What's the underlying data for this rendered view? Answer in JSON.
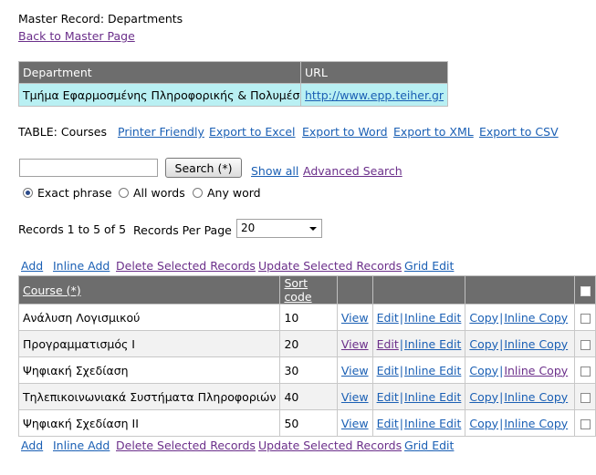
{
  "master": {
    "title": "Master Record: Departments",
    "back_link": "Back to Master Page",
    "headers": [
      "Department",
      "URL"
    ],
    "department": "Τμήμα Εφαρμοσμένης Πληροφορικής & Πολυμέσω□",
    "url": "http://www.epp.teiher.gr"
  },
  "table_label": "TABLE: Courses",
  "export_links": [
    "Printer Friendly",
    "Export to Excel",
    "Export to Word",
    "Export to XML",
    "Export to CSV"
  ],
  "search": {
    "value": "",
    "button_label": "Search (*)",
    "show_all": "Show all",
    "advanced": "Advanced Search",
    "options": [
      "Exact phrase",
      "All words",
      "Any word"
    ],
    "selected_option": "Exact phrase"
  },
  "records": {
    "info": "Records 1 to 5 of 5",
    "per_page_label": "Records Per Page",
    "per_page_value": "20"
  },
  "actions": [
    "Add",
    "Inline Add",
    "Delete Selected Records",
    "Update Selected Records",
    "Grid Edit"
  ],
  "grid": {
    "headers": [
      "Course (*)",
      "Sort code"
    ],
    "row_links": [
      "View",
      "Edit",
      "Inline Edit",
      "Copy",
      "Inline Copy"
    ],
    "rows": [
      {
        "course": "Ανάλυση Λογισμικού",
        "sort_code": "10"
      },
      {
        "course": "Προγραμματισμός Ι",
        "sort_code": "20"
      },
      {
        "course": "Ψηφιακή Σχεδίαση",
        "sort_code": "30"
      },
      {
        "course": "Τηλεπικοινωνιακά Συστήματα Πληροφοριών",
        "sort_code": "40"
      },
      {
        "course": "Ψηφιακή Σχεδίαση ΙΙ",
        "sort_code": "50"
      }
    ]
  }
}
